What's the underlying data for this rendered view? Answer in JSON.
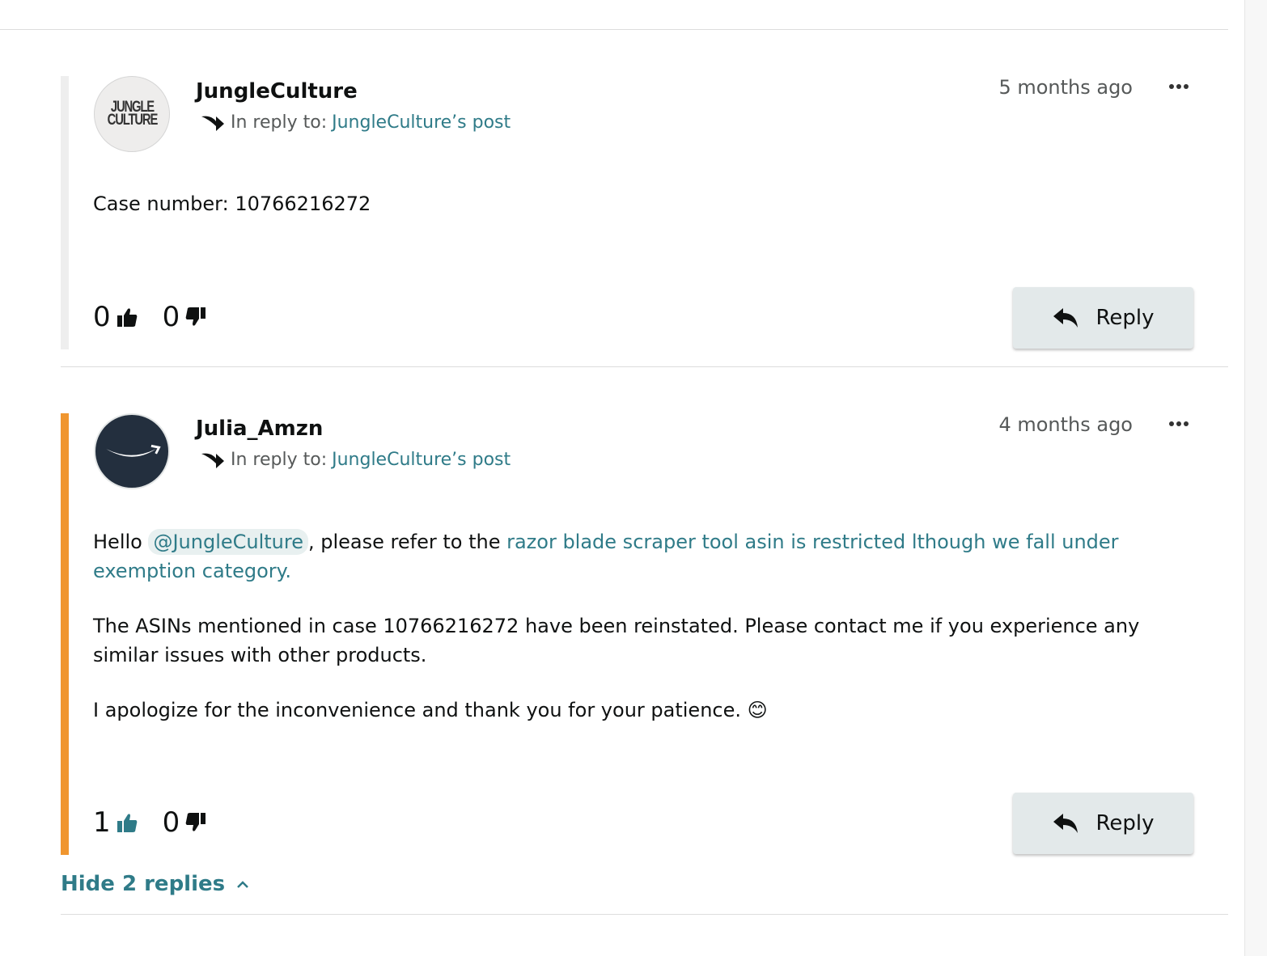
{
  "colors": {
    "accent": "#2f7b88",
    "employee_bar": "#f0962f",
    "default_bar": "#eeeeee"
  },
  "posts": [
    {
      "author": "JungleCulture",
      "avatar_text": "JUNGLE CULTURE",
      "in_reply_label": "In reply to:",
      "in_reply_link": "JungleCulture’s post",
      "timestamp": "5 months ago",
      "body": "Case number: 10766216272",
      "upvotes": "0",
      "downvotes": "0",
      "reply_label": "Reply"
    },
    {
      "author": "Julia_Amzn",
      "avatar_icon": "amazon-smile-icon",
      "in_reply_label": "In reply to:",
      "in_reply_link": "JungleCulture’s post",
      "timestamp": "4 months ago",
      "body_p1_prefix": "Hello ",
      "mention": "@JungleCulture",
      "body_p1_middle": ", please refer to the ",
      "body_p1_link": "razor blade scraper tool asin is restricted lthough we fall under exemption category.",
      "body_p2": "The ASINs mentioned in case 10766216272 have been reinstated. Please contact me if you experience any similar issues with other products.",
      "body_p3": "I apologize for the inconvenience and thank you for your patience. 😊",
      "upvotes": "1",
      "downvotes": "0",
      "reply_label": "Reply"
    }
  ],
  "hide_replies_label": "Hide 2 replies"
}
